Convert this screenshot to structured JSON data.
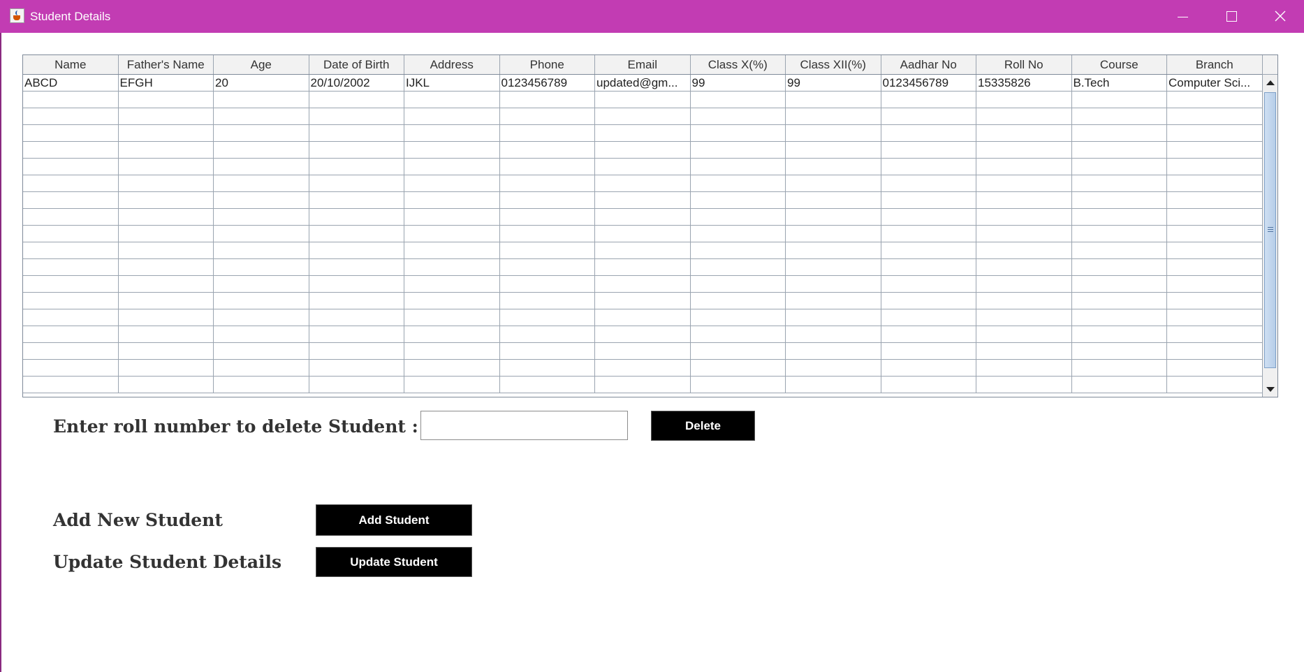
{
  "window": {
    "title": "Student Details",
    "accent_color": "#c23cb3",
    "controls": [
      "minimize-icon",
      "maximize-icon",
      "close-icon"
    ]
  },
  "table": {
    "columns": [
      "Name",
      "Father's Name",
      "Age",
      "Date of Birth",
      "Address",
      "Phone",
      "Email",
      "Class X(%)",
      "Class XII(%)",
      "Aadhar No",
      "Roll No",
      "Course",
      "Branch"
    ],
    "rows": [
      [
        "ABCD",
        "EFGH",
        "20",
        "20/10/2002",
        "IJKL",
        "0123456789",
        "updated@gm...",
        "99",
        "99",
        "0123456789",
        "15335826",
        "B.Tech",
        "Computer Sci..."
      ]
    ],
    "empty_rows": 18
  },
  "delete_section": {
    "label": "Enter roll number to delete Student :",
    "input_value": "",
    "button_label": "Delete"
  },
  "add_section": {
    "label": "Add New Student",
    "button_label": "Add Student"
  },
  "update_section": {
    "label": "Update Student Details",
    "button_label": "Update Student"
  }
}
